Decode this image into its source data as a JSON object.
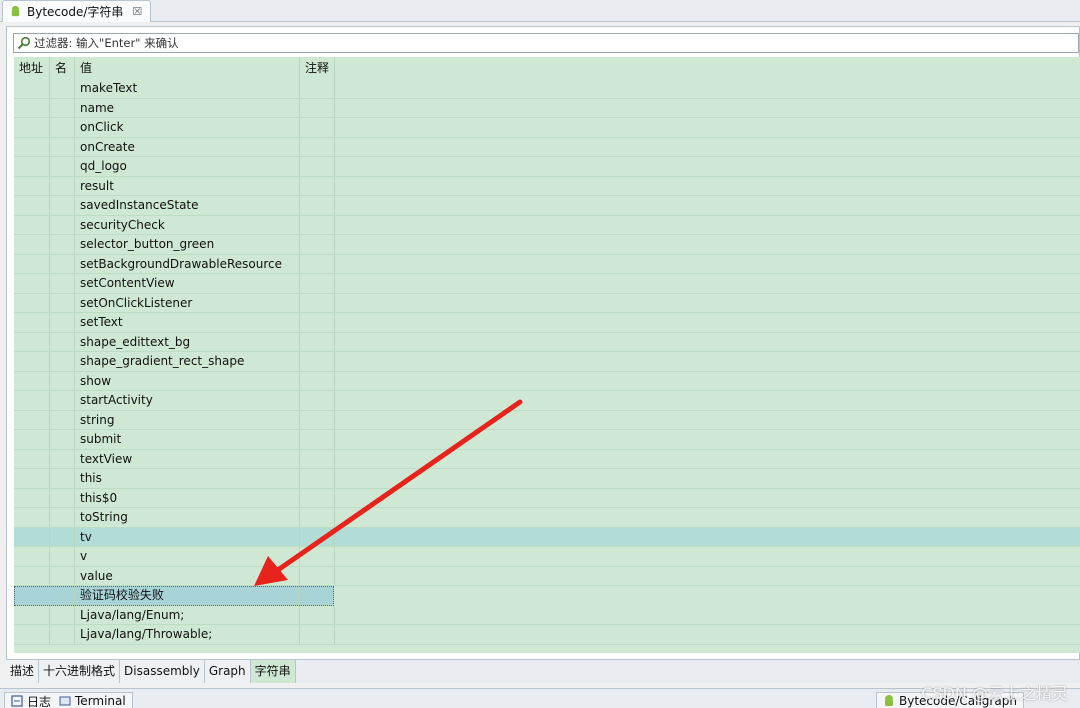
{
  "editor_tab": {
    "label": "Bytecode/字符串",
    "close": "☒"
  },
  "filter": {
    "placeholder": "过滤器: 输入\"Enter\" 来确认"
  },
  "table": {
    "headers": {
      "addr": "地址",
      "name": "名",
      "value": "值",
      "note": "注释"
    },
    "rows": [
      "makeText",
      "name",
      "onClick",
      "onCreate",
      "qd_logo",
      "result",
      "savedInstanceState",
      "securityCheck",
      "selector_button_green",
      "setBackgroundDrawableResource",
      "setContentView",
      "setOnClickListener",
      "setText",
      "shape_edittext_bg",
      "shape_gradient_rect_shape",
      "show",
      "startActivity",
      "string",
      "submit",
      "textView",
      "this",
      "this$0",
      "toString",
      "tv",
      "v",
      "value",
      "验证码校验失败",
      "Ljava/lang/Enum;",
      "Ljava/lang/Throwable;"
    ]
  },
  "bottom_tabs": [
    "描述",
    "十六进制格式",
    "Disassembly",
    "Graph",
    "字符串"
  ],
  "view_tabs": {
    "log": "日志",
    "terminal": "Terminal",
    "callgraph": "Bytecode/Callgraph"
  },
  "watermark": "CSDN @云上之精灵",
  "colors": {
    "table_bg": "#cfe8d3",
    "selected_row": "#b2dcd6",
    "arrow": "#e8231c"
  }
}
